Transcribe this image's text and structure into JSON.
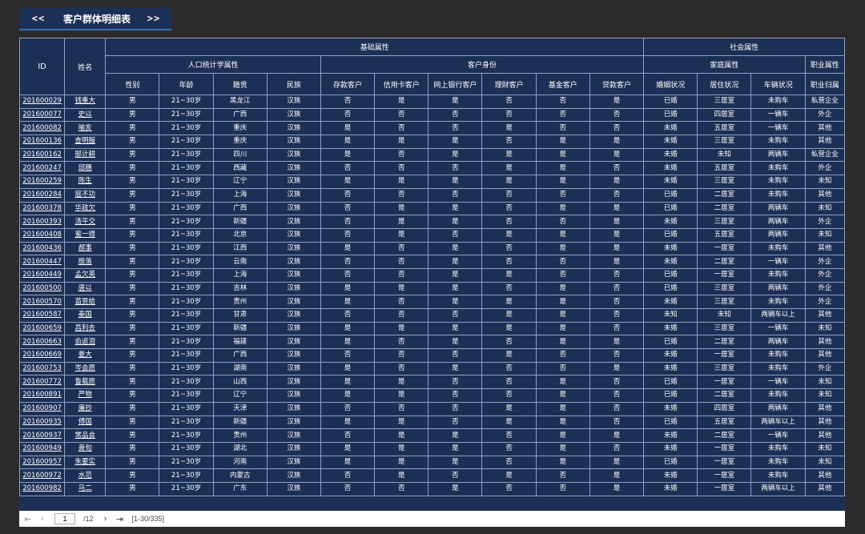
{
  "header": {
    "prev_label": "<<",
    "title": "客户群体明细表",
    "next_label": ">>"
  },
  "table": {
    "group_top_left": "ID",
    "group_name": "姓名",
    "group_basic": "基础属性",
    "group_social": "社会属性",
    "sub_demographic": "人口统计学属性",
    "sub_identity": "客户身份",
    "sub_family": "家庭属性",
    "sub_job": "职业属性",
    "columns": [
      "性别",
      "年龄",
      "籍贯",
      "民族",
      "存款客户",
      "信用卡客户",
      "网上银行客户",
      "理财客户",
      "基金客户",
      "贷款客户",
      "婚姻状况",
      "居住状况",
      "车辆状况",
      "职业归属"
    ],
    "rows": [
      [
        "201600029",
        "钱重大",
        "男",
        "21~30岁",
        "黑龙江",
        "汉族",
        "否",
        "是",
        "是",
        "否",
        "否",
        "是",
        "已婚",
        "三居室",
        "未购车",
        "私营企业"
      ],
      [
        "201600077",
        "史以",
        "男",
        "21~30岁",
        "广西",
        "汉族",
        "否",
        "否",
        "否",
        "否",
        "否",
        "否",
        "已婚",
        "四居室",
        "一辆车",
        "外企"
      ],
      [
        "201600082",
        "喻亥",
        "男",
        "21~30岁",
        "重庆",
        "汉族",
        "是",
        "否",
        "否",
        "是",
        "否",
        "否",
        "未婚",
        "五居室",
        "一辆车",
        "其他"
      ],
      [
        "201600136",
        "查明服",
        "男",
        "21~30岁",
        "重庆",
        "汉族",
        "是",
        "是",
        "是",
        "否",
        "是",
        "是",
        "未婚",
        "三居室",
        "未购车",
        "其他"
      ],
      [
        "201600162",
        "郜计耕",
        "男",
        "21~30岁",
        "四川",
        "汉族",
        "是",
        "否",
        "是",
        "是",
        "是",
        "是",
        "未婚",
        "未知",
        "两辆车",
        "私营企业"
      ],
      [
        "201600247",
        "邱穗",
        "男",
        "21~30岁",
        "西藏",
        "汉族",
        "否",
        "否",
        "否",
        "是",
        "是",
        "否",
        "未婚",
        "五居室",
        "未购车",
        "外企"
      ],
      [
        "201600259",
        "陈生",
        "男",
        "21~30岁",
        "辽宁",
        "汉族",
        "是",
        "是",
        "是",
        "是",
        "是",
        "是",
        "未婚",
        "三居室",
        "未购车",
        "未知"
      ],
      [
        "201600284",
        "寇不功",
        "男",
        "21~30岁",
        "上海",
        "汉族",
        "否",
        "否",
        "否",
        "否",
        "否",
        "否",
        "已婚",
        "二居室",
        "未购车",
        "其他"
      ],
      [
        "201600378",
        "华政欠",
        "男",
        "21~30岁",
        "广西",
        "汉族",
        "否",
        "是",
        "是",
        "否",
        "是",
        "是",
        "已婚",
        "二居室",
        "两辆车",
        "未知"
      ],
      [
        "201600393",
        "汤平交",
        "男",
        "21~30岁",
        "新疆",
        "汉族",
        "否",
        "是",
        "是",
        "否",
        "否",
        "是",
        "未婚",
        "三居室",
        "两辆车",
        "外企"
      ],
      [
        "201600408",
        "蜜一得",
        "男",
        "21~30岁",
        "北京",
        "汉族",
        "否",
        "是",
        "否",
        "是",
        "是",
        "是",
        "已婚",
        "五居室",
        "两辆车",
        "未知"
      ],
      [
        "201600436",
        "郝事",
        "男",
        "21~30岁",
        "江西",
        "汉族",
        "是",
        "否",
        "是",
        "否",
        "是",
        "是",
        "未婚",
        "一居室",
        "未购车",
        "其他"
      ],
      [
        "201600447",
        "殷落",
        "男",
        "21~30岁",
        "云南",
        "汉族",
        "否",
        "否",
        "是",
        "否",
        "否",
        "是",
        "未婚",
        "二居室",
        "一辆车",
        "外企"
      ],
      [
        "201600449",
        "孟欠英",
        "男",
        "21~30岁",
        "上海",
        "汉族",
        "否",
        "否",
        "是",
        "是",
        "否",
        "否",
        "已婚",
        "一居室",
        "未购车",
        "外企"
      ],
      [
        "201600500",
        "唐以",
        "男",
        "21~30岁",
        "吉林",
        "汉族",
        "是",
        "是",
        "是",
        "否",
        "是",
        "否",
        "已婚",
        "三居室",
        "两辆车",
        "外企"
      ],
      [
        "201600570",
        "苗贾给",
        "男",
        "21~30岁",
        "贵州",
        "汉族",
        "是",
        "否",
        "是",
        "是",
        "是",
        "否",
        "未婚",
        "三居室",
        "未购车",
        "外企"
      ],
      [
        "201600587",
        "秦国",
        "男",
        "21~30岁",
        "甘肃",
        "汉族",
        "否",
        "否",
        "否",
        "是",
        "是",
        "否",
        "未知",
        "未知",
        "两辆车以上",
        "其他"
      ],
      [
        "201600659",
        "昌利去",
        "男",
        "21~30岁",
        "新疆",
        "汉族",
        "是",
        "是",
        "是",
        "是",
        "是",
        "否",
        "未婚",
        "三居室",
        "一辆车",
        "未知"
      ],
      [
        "201600663",
        "俞返泪",
        "男",
        "21~30岁",
        "福建",
        "汉族",
        "是",
        "否",
        "是",
        "否",
        "是",
        "是",
        "已婚",
        "二居室",
        "两辆车",
        "其他"
      ],
      [
        "201600669",
        "姜大",
        "男",
        "21~30岁",
        "广西",
        "汉族",
        "否",
        "否",
        "否",
        "是",
        "否",
        "否",
        "未婚",
        "一居室",
        "未购车",
        "其他"
      ],
      [
        "201600753",
        "岑会愿",
        "男",
        "21~30岁",
        "湖南",
        "汉族",
        "是",
        "否",
        "是",
        "否",
        "否",
        "是",
        "未婚",
        "三居室",
        "未购车",
        "外企"
      ],
      [
        "201600772",
        "鲁载愿",
        "男",
        "21~30岁",
        "山西",
        "汉族",
        "是",
        "是",
        "否",
        "否",
        "是",
        "否",
        "已婚",
        "一居室",
        "一辆车",
        "未知"
      ],
      [
        "201600891",
        "严物",
        "男",
        "21~30岁",
        "辽宁",
        "汉族",
        "是",
        "是",
        "否",
        "否",
        "是",
        "否",
        "已婚",
        "二居室",
        "未购车",
        "未知"
      ],
      [
        "201600907",
        "廉抄",
        "男",
        "21~30岁",
        "天津",
        "汉族",
        "否",
        "否",
        "否",
        "是",
        "是",
        "否",
        "未婚",
        "四居室",
        "两辆车",
        "其他"
      ],
      [
        "201600935",
        "傅国",
        "男",
        "21~30岁",
        "新疆",
        "汉族",
        "是",
        "是",
        "否",
        "是",
        "是",
        "否",
        "已婚",
        "五居室",
        "两辆车以上",
        "其他"
      ],
      [
        "201600937",
        "常品会",
        "男",
        "21~30岁",
        "贵州",
        "汉族",
        "否",
        "是",
        "是",
        "否",
        "是",
        "是",
        "未婚",
        "二居室",
        "一辆车",
        "其他"
      ],
      [
        "201600949",
        "萧旬",
        "男",
        "21~30岁",
        "湖北",
        "汉族",
        "是",
        "是",
        "是",
        "否",
        "是",
        "否",
        "未婚",
        "一居室",
        "未购车",
        "未知"
      ],
      [
        "201600957",
        "朱要实",
        "男",
        "21~30岁",
        "河南",
        "汉族",
        "是",
        "是",
        "是",
        "否",
        "是",
        "是",
        "已婚",
        "一居室",
        "未购车",
        "未知"
      ],
      [
        "201600972",
        "水范",
        "男",
        "21~30岁",
        "内蒙古",
        "汉族",
        "否",
        "是",
        "否",
        "是",
        "否",
        "是",
        "未婚",
        "一居室",
        "未购车",
        "其他"
      ],
      [
        "201600982",
        "马二",
        "男",
        "21~30岁",
        "广东",
        "汉族",
        "否",
        "否",
        "是",
        "否",
        "否",
        "是",
        "未婚",
        "一居室",
        "两辆车以上",
        "其他"
      ]
    ]
  },
  "pager": {
    "first_icon": "first-page-icon",
    "prev_icon": "prev-page-icon",
    "current_page": "1",
    "total_pages": "/12",
    "next_icon": "next-page-icon",
    "last_icon": "last-page-icon",
    "range": "[1-30/335]"
  },
  "colors": {
    "background": "#2b2b2b",
    "table_bg": "#1c2f55",
    "grid": "#8fa3c2",
    "text": "#ffffff"
  }
}
